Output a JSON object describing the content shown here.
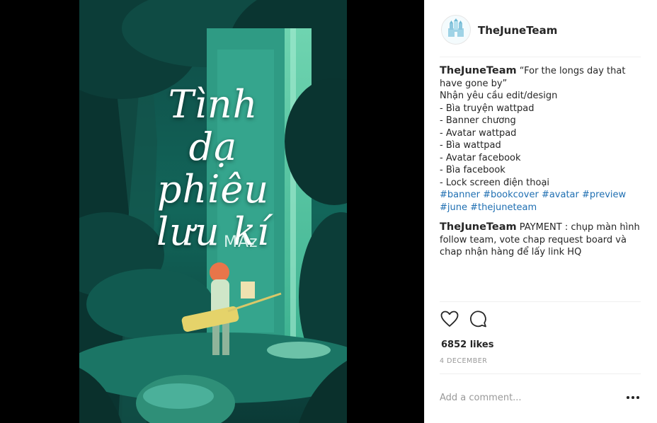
{
  "post": {
    "username": "TheJuneTeam",
    "avatar_icon": "castle-logo-icon",
    "cover": {
      "title_lines": [
        "Tình",
        "dạ",
        "phiêu",
        "lưu kí"
      ],
      "author": "MAz"
    },
    "caption": {
      "username": "TheJuneTeam",
      "lines": [
        "“For the longs day that have gone by”",
        "Nhận yêu cầu edit/design",
        "- Bìa truyện wattpad",
        "- Banner chương",
        "- Avatar wattpad",
        "- Bìa wattpad",
        "- Avatar facebook",
        "- Bìa facebook",
        "- Lock screen điện thoại"
      ],
      "hashtags": [
        "#banner",
        "#bookcover",
        "#avatar",
        "#preview",
        "#june",
        "#thejuneteam"
      ]
    },
    "comment": {
      "username": "TheJuneTeam",
      "text": "PAYMENT : chụp màn hình follow team, vote chap request board và chap nhận hàng để lấy link HQ"
    },
    "likes": "6852 likes",
    "date": "4 DECEMBER",
    "add_comment_placeholder": "Add a comment...",
    "icons": [
      "heart-icon",
      "comment-icon",
      "more-icon"
    ]
  }
}
